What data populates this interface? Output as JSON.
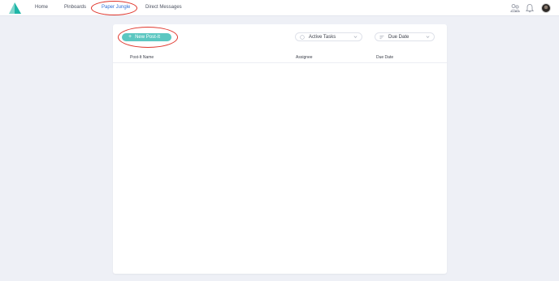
{
  "nav": {
    "items": [
      {
        "label": "Home"
      },
      {
        "label": "Pinboards"
      },
      {
        "label": "Paper Jungle"
      },
      {
        "label": "Direct Messages"
      }
    ]
  },
  "icons": {
    "logo": "triangle-logo-icon",
    "people": "people-icon",
    "bell": "bell-icon"
  },
  "colors": {
    "accent": "#5cc7c1",
    "annotation": "#e0362c",
    "background": "#eef0f6"
  },
  "toolbar": {
    "new_button_icon": "+",
    "new_button_label": "New Post-It",
    "filter_label": "Active Tasks",
    "sort_label": "Due Date"
  },
  "table": {
    "columns": [
      "Post-It Name",
      "Assignee",
      "Due Date"
    ],
    "rows": []
  }
}
